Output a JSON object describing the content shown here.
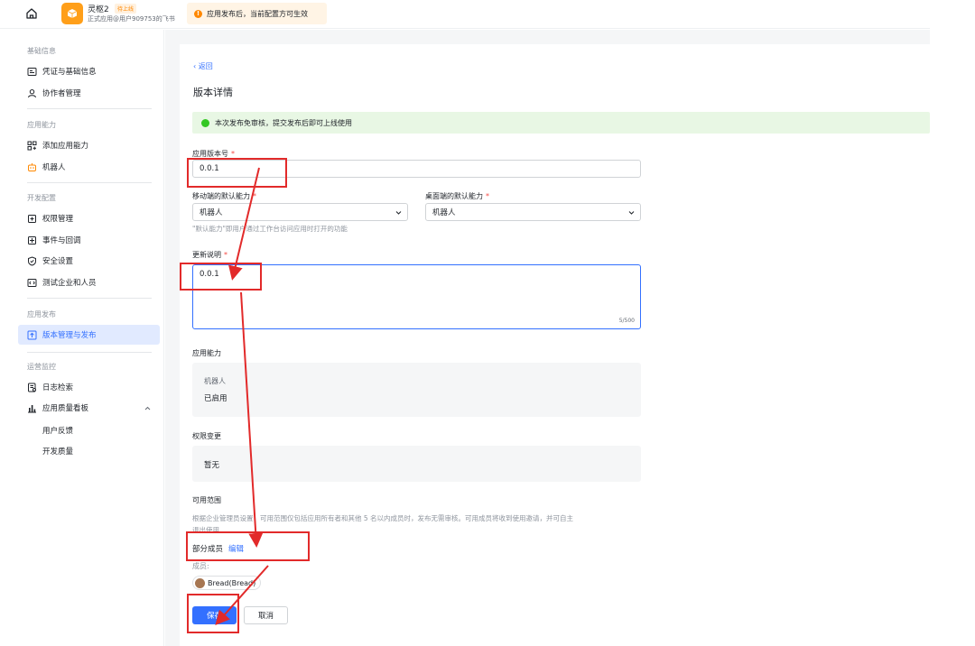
{
  "topbar": {
    "app_name": "灵枢2",
    "app_badge": "待上线",
    "app_sub": "正式应用@用户909753的飞书",
    "notice": "应用发布后，当前配置方可生效"
  },
  "sidebar": {
    "groups": {
      "basic": "基础信息",
      "ability": "应用能力",
      "dev": "开发配置",
      "release": "应用发布",
      "ops": "运营监控"
    },
    "items": {
      "credentials": "凭证与基础信息",
      "collaborators": "协作者管理",
      "add_ability": "添加应用能力",
      "robot": "机器人",
      "permissions": "权限管理",
      "events": "事件与回调",
      "security": "安全设置",
      "test_org": "测试企业和人员",
      "version_mgmt": "版本管理与发布",
      "log_search": "日志检索",
      "quality_board": "应用质量看板",
      "user_feedback": "用户反馈",
      "dev_quality": "开发质量"
    }
  },
  "main": {
    "back": "返回",
    "title": "版本详情",
    "success_msg": "本次发布免审核，提交发布后即可上线使用",
    "version_label": "应用版本号",
    "version_value": "0.0.1",
    "mobile_label": "移动端的默认能力",
    "mobile_value": "机器人",
    "desktop_label": "桌面端的默认能力",
    "desktop_value": "机器人",
    "default_hint": "\"默认能力\"即用户通过工作台访问应用时打开的功能",
    "update_label": "更新说明",
    "update_value": "0.0.1",
    "update_count": "5/500",
    "ability_label": "应用能力",
    "ability_name": "机器人",
    "ability_status": "已启用",
    "perm_label": "权限变更",
    "perm_value": "暂无",
    "scope_label": "可用范围",
    "scope_hint_1": "根据企业管理员设置，可用范围仅包括应用所有者和其他 5 名以内成员时，发布无需审核。可用成员将收到使用邀请，并可自主",
    "scope_hint_2": "退出使用",
    "partial_members": "部分成员",
    "edit": "编辑",
    "members_label": "成员:",
    "member_chip": "Bread(Bread)",
    "save": "保存",
    "cancel": "取消"
  },
  "colors": {
    "primary": "#3370ff",
    "annotation": "#e22a2a",
    "success_bg": "#e8f7e4",
    "notice_bg": "#fff4e5"
  }
}
